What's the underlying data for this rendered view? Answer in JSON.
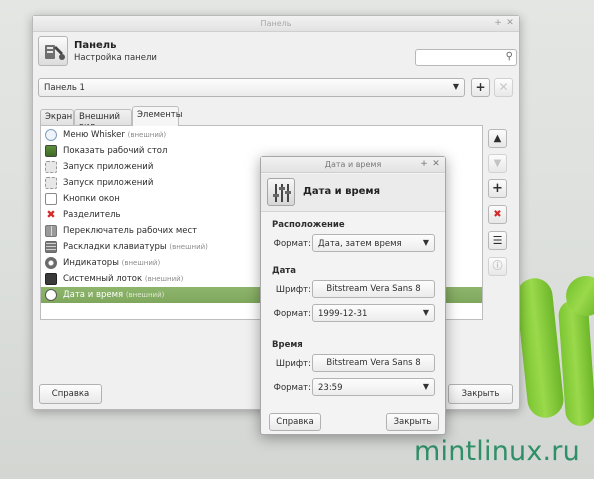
{
  "brand_text": "mintlinux.ru",
  "main_window": {
    "title": "Панель",
    "header_title": "Панель",
    "header_subtitle": "Настройка панели",
    "panel_combo_value": "Панель 1",
    "tabs": [
      {
        "label": "Экран"
      },
      {
        "label": "Внешний вид"
      },
      {
        "label": "Элементы"
      }
    ],
    "items": [
      {
        "name": "Меню Whisker",
        "ext": "(внешний)",
        "icon": "whisker-menu-icon"
      },
      {
        "name": "Показать рабочий стол",
        "ext": "",
        "icon": "desktop-icon"
      },
      {
        "name": "Запуск приложений",
        "ext": "",
        "icon": "launcher-icon"
      },
      {
        "name": "Запуск приложений",
        "ext": "",
        "icon": "launcher-icon"
      },
      {
        "name": "Кнопки окон",
        "ext": "",
        "icon": "window-buttons-icon"
      },
      {
        "name": "Разделитель",
        "ext": "",
        "icon": "separator-x-icon"
      },
      {
        "name": "Переключатель рабочих мест",
        "ext": "",
        "icon": "workspace-switcher-icon"
      },
      {
        "name": "Раскладки клавиатуры",
        "ext": "(внешний)",
        "icon": "keyboard-icon"
      },
      {
        "name": "Индикаторы",
        "ext": "(внешний)",
        "icon": "indicator-icon"
      },
      {
        "name": "Системный лоток",
        "ext": "(внешний)",
        "icon": "system-tray-icon"
      },
      {
        "name": "Дата и время",
        "ext": "(внешний)",
        "icon": "clock-icon",
        "selected": true
      }
    ],
    "help_button": "Справка",
    "close_button": "Закрыть"
  },
  "dialog": {
    "title": "Дата и время",
    "header_title": "Дата и время",
    "layout_section": "Расположение",
    "format_label": "Формат:",
    "layout_format_value": "Дата, затем время",
    "date_section": "Дата",
    "font_label": "Шрифт:",
    "date_font_value": "Bitstream Vera Sans 8",
    "date_format_value": "1999-12-31",
    "time_section": "Время",
    "time_font_value": "Bitstream Vera Sans 8",
    "time_format_value": "23:59",
    "help_button": "Справка",
    "close_button": "Закрыть"
  },
  "colors": {
    "selection_green": "#87ae65",
    "mint_green": "#8ad13f",
    "brand_teal": "#2f8f68",
    "remove_red": "#d42a2a"
  }
}
